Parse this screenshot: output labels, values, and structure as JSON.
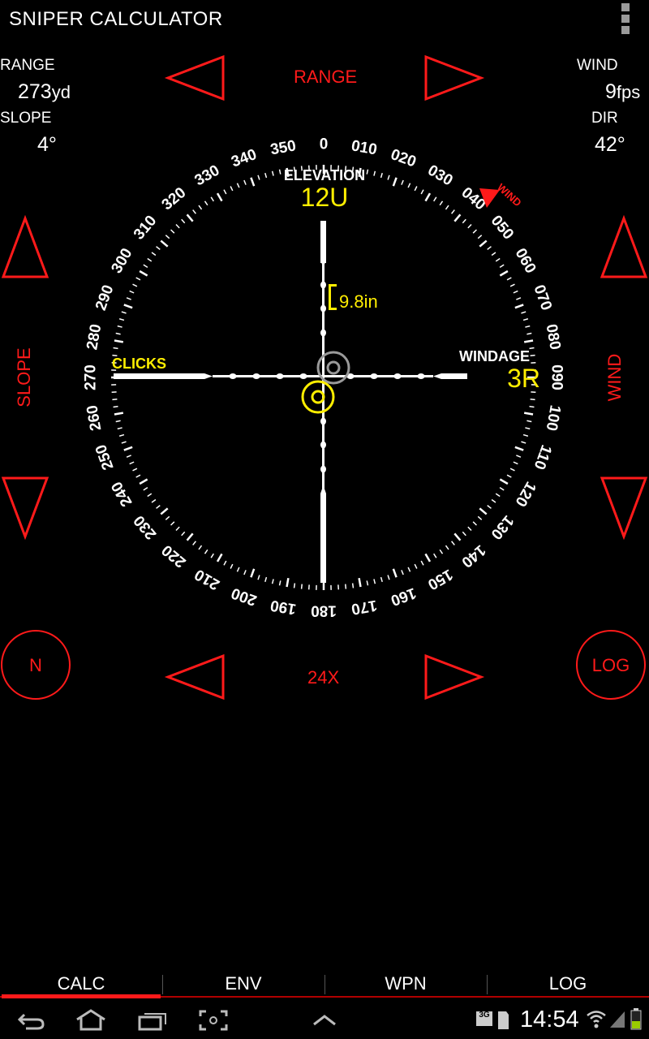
{
  "app": {
    "title": "SNIPER CALCULATOR"
  },
  "readouts": {
    "range_label": "RANGE",
    "range_value": "273",
    "range_unit": "yd",
    "slope_label": "SLOPE",
    "slope_value": "4°",
    "wind_label": "WIND",
    "wind_value": "9",
    "wind_unit": "fps",
    "dir_label": "DIR",
    "dir_value": "42°"
  },
  "controls": {
    "range_label": "RANGE",
    "slope_label": "SLOPE",
    "wind_label": "WIND",
    "zoom_label": "24X",
    "north_label": "N",
    "log_label": "LOG"
  },
  "scope": {
    "elevation_label": "ELEVATION",
    "elevation_value": "12U",
    "windage_label": "WINDAGE",
    "windage_value": "3R",
    "clicks_label": "CLICKS",
    "drop_label": "9.8in",
    "wind_marker_label": "WIND",
    "wind_direction_deg": 42,
    "compass_labels": [
      "0",
      "010",
      "020",
      "030",
      "040",
      "050",
      "060",
      "070",
      "080",
      "090",
      "100",
      "110",
      "120",
      "130",
      "140",
      "150",
      "160",
      "170",
      "180",
      "190",
      "200",
      "210",
      "220",
      "230",
      "240",
      "250",
      "260",
      "270",
      "280",
      "290",
      "300",
      "310",
      "320",
      "330",
      "340",
      "350"
    ]
  },
  "tabs": [
    {
      "label": "CALC",
      "active": true
    },
    {
      "label": "ENV",
      "active": false
    },
    {
      "label": "WPN",
      "active": false
    },
    {
      "label": "LOG",
      "active": false
    }
  ],
  "status": {
    "time": "14:54",
    "network": "3G"
  },
  "colors": {
    "accent": "#ff1a1a",
    "scope_yellow": "#ffee00",
    "tab_active": "#ff1a1a"
  }
}
